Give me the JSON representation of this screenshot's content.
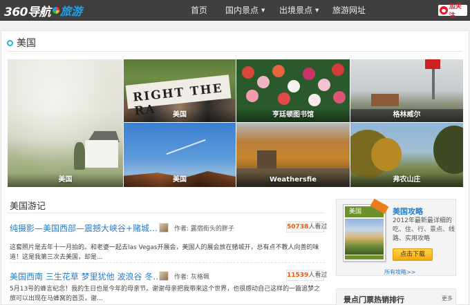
{
  "logo": {
    "brand": "360导航",
    "product": "旅游"
  },
  "nav": [
    {
      "label": "首页",
      "dropdown": false
    },
    {
      "label": "国内景点",
      "dropdown": true
    },
    {
      "label": "出境景点",
      "dropdown": true
    },
    {
      "label": "旅游网址",
      "dropdown": false
    }
  ],
  "follow_button": {
    "label": "加关注",
    "icon": "weibo-icon"
  },
  "section": {
    "title": "美国"
  },
  "photos": [
    {
      "caption": "美国"
    },
    {
      "caption": "美国"
    },
    {
      "caption": "亨廷顿图书馆"
    },
    {
      "caption": "格林威尔"
    },
    {
      "caption": "美国"
    },
    {
      "caption": "Weathersfie"
    },
    {
      "caption": "弗农山庄"
    }
  ],
  "travelogues": {
    "title": "美国游记",
    "entries": [
      {
        "title": "纯摄影—美国西部—震撼大峡谷+赌城…",
        "author_label": "作者:",
        "author": "露宿街头的胖子",
        "views": "50738",
        "views_suffix": "人看过",
        "excerpt": "这套照片是去年十一月拍的。和老婆一起去las Vegas开展会，美国人的展会放在赌城开，总有点不教人向善的味道！这是我第三次去美国，却是..."
      },
      {
        "title": "美国西南 三生花草 梦里犹他 波浪谷 冬…",
        "author_label": "作者:",
        "author": "灰格珮",
        "views": "11539",
        "views_suffix": "人看过",
        "excerpt": "5月13号的蜂言纪念！我的生日也是今年的母亲节。谢谢母亲把我带来这个世界，也很感动自己这样的一篇追梦之旅可以出现在马蜂窝的首页，谢..."
      }
    ]
  },
  "guide": {
    "cover_label": "美国",
    "title": "美国攻略",
    "description": "2012年最新最详细的吃、住、行、景点、线路、实用攻略",
    "download_label": "点击下载",
    "all_guides_label": "所有攻略>>"
  },
  "ranking": {
    "title": "景点门票热销排行",
    "more_label": "更多"
  },
  "colors": {
    "topbar": "#3f3f3f",
    "link": "#2a7cc4",
    "accent_orange": "#e55a0c",
    "download_button": "#f5a90d"
  }
}
